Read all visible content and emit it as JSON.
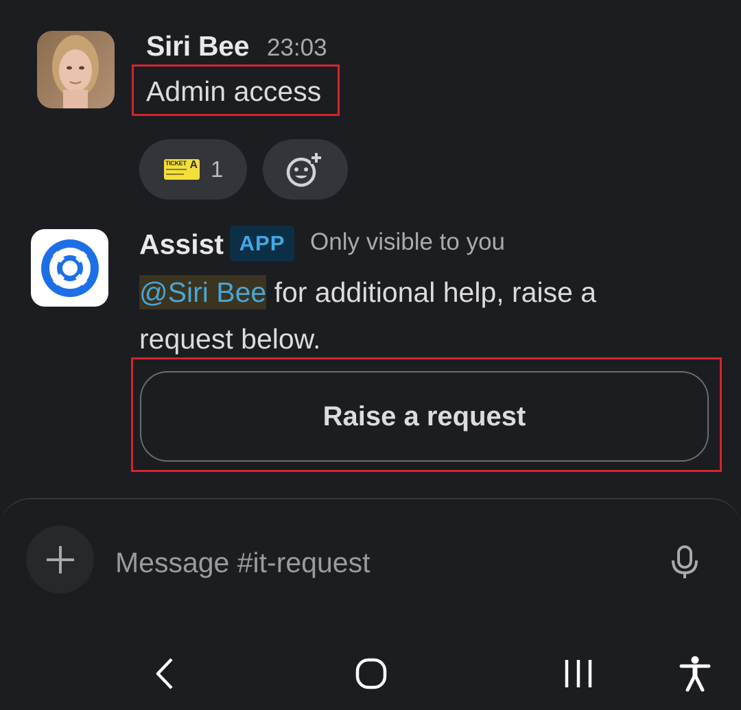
{
  "messages": [
    {
      "sender": "Siri Bee",
      "time": "23:03",
      "text": "Admin access",
      "reaction": {
        "emoji": "ticket-emoji",
        "ticket_word": "TICKET",
        "ticket_letter": "A",
        "count": "1"
      },
      "add_reaction_icon": "add-reaction-icon"
    },
    {
      "sender": "Assist",
      "badge": "APP",
      "visibility": "Only visible to you",
      "mention": "@Siri Bee",
      "text_after_mention": " for additional help, raise a request below.",
      "button_label": "Raise a request"
    }
  ],
  "composer": {
    "placeholder": "Message #it-request",
    "plus_icon": "plus-icon",
    "mic_icon": "microphone-icon"
  },
  "navbar": {
    "icons": [
      "back-icon",
      "home-icon",
      "recent-apps-icon",
      "accessibility-icon"
    ]
  },
  "colors": {
    "background": "#1b1d21",
    "highlight": "#d6242d",
    "mention": "#4aa5d5",
    "app_badge_text": "#3fa9e6",
    "app_icon_blue": "#1d6fe8"
  }
}
